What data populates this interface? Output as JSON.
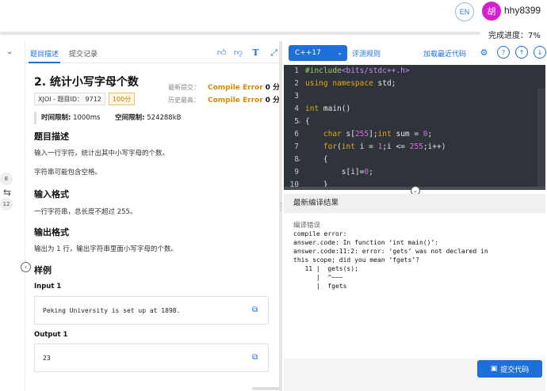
{
  "header": {
    "lang_button": "EN",
    "avatar_char": "胡",
    "username": "hhy8399",
    "progress_label": "完成进度：7%",
    "progress_value": 0.07
  },
  "rail": {
    "circle_1": "6",
    "circle_2": "12"
  },
  "problem": {
    "tabs": [
      "题目描述",
      "提交记录"
    ],
    "title": "2.  统计小写字母个数",
    "tags": [
      "XJOI - 题目ID： 9712",
      "100分"
    ],
    "recent_label": "最新提交：",
    "recent_status": "Compile Error",
    "recent_score": "0 分",
    "best_label": "历史最高：",
    "best_status": "Compile Error",
    "best_score": "0 分",
    "time_label": "时间限制:",
    "time_value": "1000ms",
    "mem_label": "空间限制:",
    "mem_value": "524288kB",
    "desc_heading": "题目描述",
    "desc_p1": "输入一行字符，统计出其中小写字母的个数。",
    "desc_p2": "字符串可能包含空格。",
    "input_heading": "输入格式",
    "input_p": "一行字符串，总长度不超过 255。",
    "output_heading": "输出格式",
    "output_p": "输出为 1 行，输出字符串里面小写字母的个数。",
    "sample_heading": "样例",
    "input1_label": "Input 1",
    "input1_value": "Peking University is set up at 1898.",
    "output1_label": "Output 1",
    "output1_value": "23"
  },
  "editor": {
    "language": "C++17",
    "eval_rules": "评测规则",
    "load_recent": "加载最近代码",
    "code_lines": [
      {
        "n": "1",
        "fold": ""
      },
      {
        "n": "2",
        "fold": ""
      },
      {
        "n": "3",
        "fold": ""
      },
      {
        "n": "4",
        "fold": ""
      },
      {
        "n": "5",
        "fold": "⌄"
      },
      {
        "n": "6",
        "fold": ""
      },
      {
        "n": "7",
        "fold": ""
      },
      {
        "n": "8",
        "fold": "⌄"
      },
      {
        "n": "9",
        "fold": ""
      },
      {
        "n": "10",
        "fold": ""
      }
    ],
    "result_header": "最新编译结果",
    "result_title": "编译错误",
    "result_text": "compile error:\nanswer.code: In function ‘int main()’:\nanswer.code:11:2: error: ‘gets’ was not declared in\nthis scope; did you mean ‘fgets’?\n   11 |  gets(s);\n      |  ^~~~\n      |  fgets",
    "submit": "提交代码"
  },
  "colors": {
    "accent": "#1e6fd9",
    "error": "#d98a00",
    "editor_bg": "#2f333a"
  }
}
